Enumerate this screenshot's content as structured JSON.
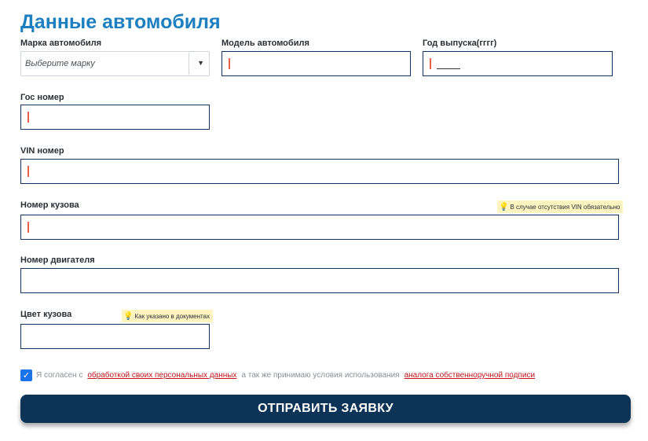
{
  "title": "Данные автомобиля",
  "fields": {
    "brand": {
      "label": "Марка автомобиля",
      "placeholder": "Выберите марку",
      "arrow": "▼"
    },
    "model": {
      "label": "Модель автомобиля"
    },
    "year": {
      "label": "Год выпуска(гггг)"
    },
    "plate": {
      "label": "Гос номер"
    },
    "vin": {
      "label": "VIN номер"
    },
    "body_number": {
      "label": "Номер кузова",
      "hint": "В случае отсутствия VIN обязательно"
    },
    "engine_number": {
      "label": "Номер двигателя"
    },
    "color": {
      "label": "Цвет кузова",
      "hint": "Как указано в документах"
    }
  },
  "consent": {
    "checked": true,
    "check_glyph": "✓",
    "text_before": "Я согласен с",
    "link1": "обработкой своих персональных данных",
    "text_middle": "а так же принимаю условия использования",
    "link2": "аналога собственноручной подписи"
  },
  "submit_label": "ОТПРАВИТЬ ЗАЯВКУ",
  "icons": {
    "hint": "lightbulb-icon",
    "dropdown": "chevron-down-icon",
    "checkbox": "check-icon"
  },
  "colors": {
    "title": "#1c7fc0",
    "border": "#113560",
    "button": "#0d3357",
    "link": "#c0131b",
    "hint_bg": "#fdf4c0",
    "caret": "#e8604a",
    "checkbox": "#1a73e8"
  }
}
